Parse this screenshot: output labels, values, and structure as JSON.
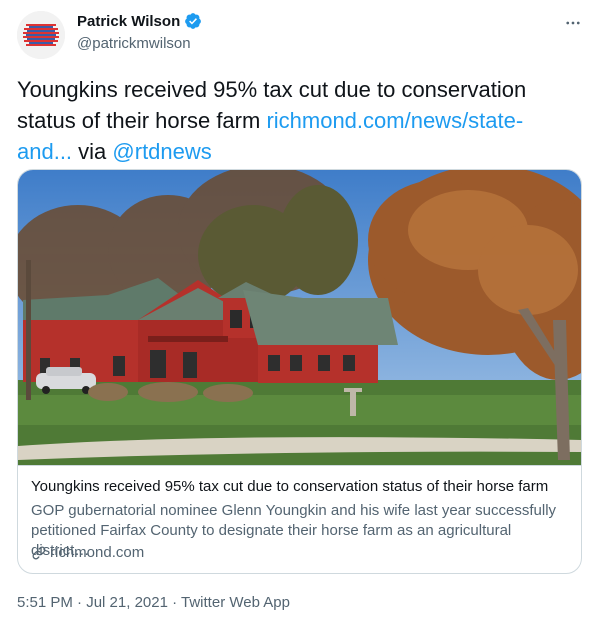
{
  "author": {
    "display_name": "Patrick Wilson",
    "handle": "@patrickmwilson",
    "verified": true
  },
  "tweet": {
    "text_plain": "Youngkins received 95% tax cut due to conservation status of their horse farm ",
    "link_text": "richmond.com/news/state-and...",
    "via_text": " via ",
    "mention": "@rtdnews"
  },
  "card": {
    "title": "Youngkins received 95% tax cut due to conservation status of their horse farm",
    "description": "GOP gubernatorial nominee Glenn Youngkin and his wife last year successfully petitioned Fairfax County to designate their horse farm as an agricultural district…",
    "domain": "richmond.com"
  },
  "meta": {
    "time": "5:51 PM",
    "sep1": " · ",
    "date": "Jul 21, 2021",
    "sep2": " · ",
    "source": "Twitter Web App"
  },
  "icons": {
    "verified": "verified-badge-icon",
    "more": "more-horizontal-icon",
    "link": "link-icon"
  },
  "colors": {
    "link": "#1d9bf0",
    "secondary_text": "#536471",
    "border": "#cfd9de",
    "barn_red": "#b5312b"
  }
}
